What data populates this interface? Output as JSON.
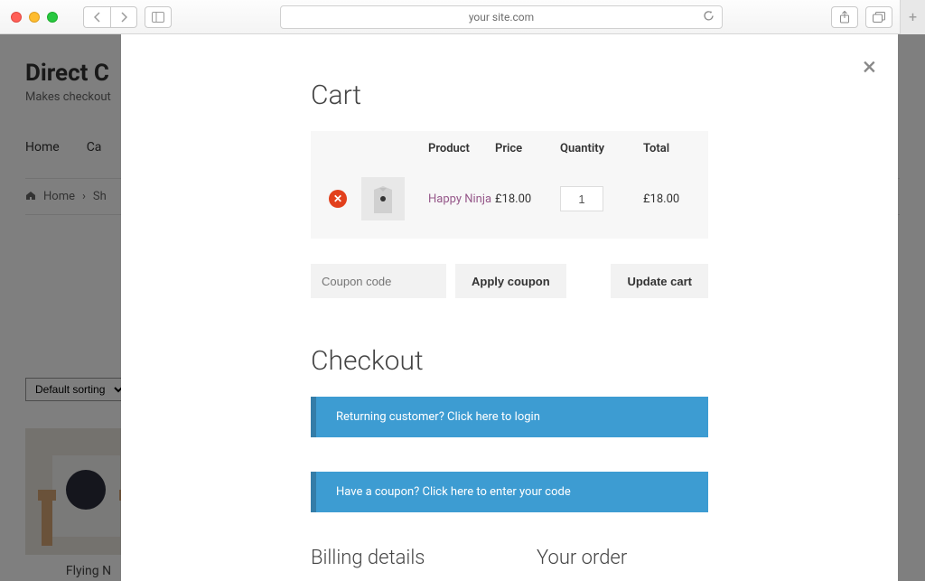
{
  "browser": {
    "url": "your site.com"
  },
  "background_page": {
    "site_title": "Direct C",
    "tagline": "Makes checkout",
    "nav": {
      "home": "Home",
      "cart": "Ca"
    },
    "breadcrumb": {
      "home": "Home",
      "next": "Sh"
    },
    "sorting": "Default sorting",
    "product": {
      "name": "Flying N"
    }
  },
  "cart": {
    "title": "Cart",
    "columns": {
      "product": "Product",
      "price": "Price",
      "quantity": "Quantity",
      "total": "Total"
    },
    "item": {
      "name": "Happy Ninja",
      "price": "£18.00",
      "quantity": "1",
      "total": "£18.00"
    },
    "coupon_placeholder": "Coupon code",
    "apply_coupon_label": "Apply coupon",
    "update_cart_label": "Update cart"
  },
  "checkout": {
    "title": "Checkout",
    "returning_customer": "Returning customer? Click here to login",
    "have_coupon": "Have a coupon? Click here to enter your code",
    "billing_title": "Billing details",
    "order_title": "Your order"
  }
}
